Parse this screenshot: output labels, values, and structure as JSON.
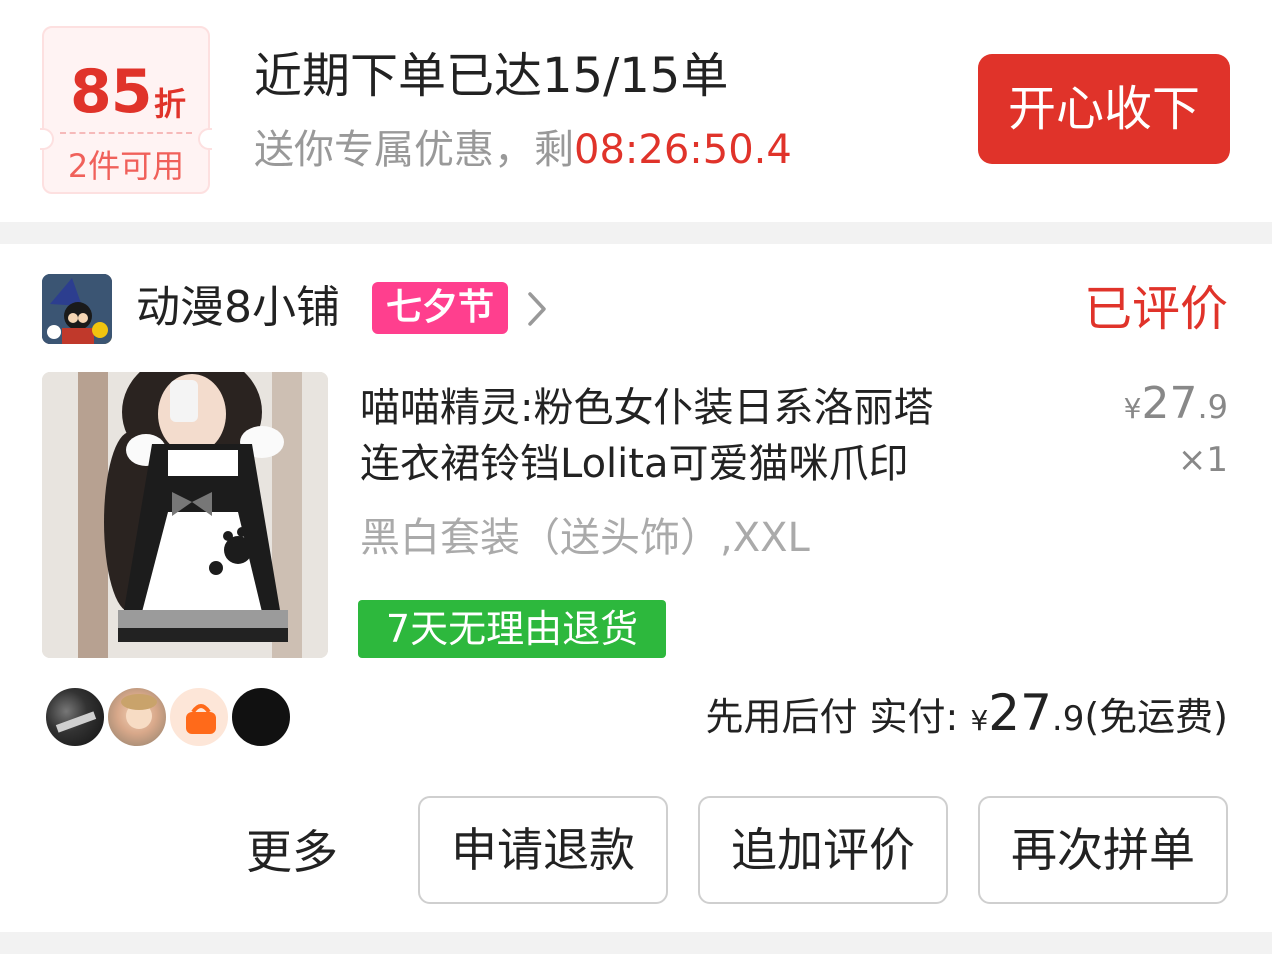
{
  "promo": {
    "coupon_discount": "85",
    "coupon_unit": "折",
    "coupon_condition": "2件可用",
    "title": "近期下单已达15/15单",
    "subtitle_prefix": "送你专属优惠，剩",
    "countdown": "08:26:50.4",
    "accept_label": "开心收下",
    "accent_color": "#e0332a"
  },
  "order": {
    "shop_name": "动漫8小铺",
    "shop_tag": "七夕节",
    "status": "已评价",
    "product_title_line1": "喵喵精灵:粉色女仆装日系洛丽塔",
    "product_title_line2": "连衣裙铃铛Lolita可爱猫咪爪印",
    "price_symbol": "¥",
    "price_int": "27",
    "price_dec": ".9",
    "quantity": "×1",
    "variant": "黑白套装（送头饰）,XXL",
    "return_badge": "7天无理由退货",
    "pay_label": "先用后付 实付: ",
    "pay_symbol": "¥",
    "pay_int": "27",
    "pay_dec": ".9",
    "pay_note": "(免运费)",
    "tag_color": "#ff3f8e",
    "badge_color": "#2db83d"
  },
  "actions": {
    "more_label": "更多",
    "refund_label": "申请退款",
    "review_label": "追加评价",
    "reorder_label": "再次拼单"
  }
}
